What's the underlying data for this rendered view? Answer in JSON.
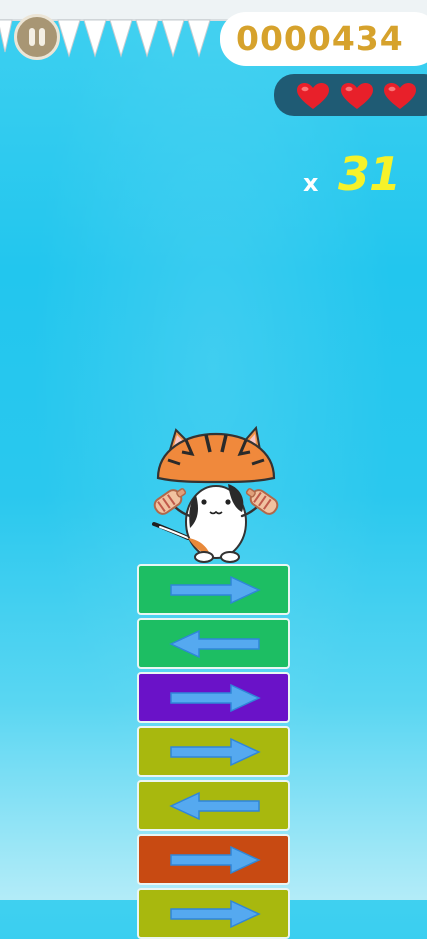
{
  "hud": {
    "pause_icon": "pause-icon",
    "score": "0000434",
    "score_color": "#d6a22c",
    "lives": 3,
    "heart_icon": "heart-icon",
    "heart_color": "#e8202a",
    "combo_prefix": "x",
    "combo_value": "31",
    "combo_color": "#f6f22a"
  },
  "player": {
    "character": "mushroom-cat"
  },
  "tiles": [
    {
      "direction": "right",
      "color": "#1dbe63"
    },
    {
      "direction": "left",
      "color": "#1dbe63"
    },
    {
      "direction": "right",
      "color": "#6a12c8"
    },
    {
      "direction": "right",
      "color": "#a8b80e"
    },
    {
      "direction": "left",
      "color": "#a8b80e"
    },
    {
      "direction": "right",
      "color": "#c84a12"
    },
    {
      "direction": "right",
      "color": "#a8b80e"
    }
  ]
}
